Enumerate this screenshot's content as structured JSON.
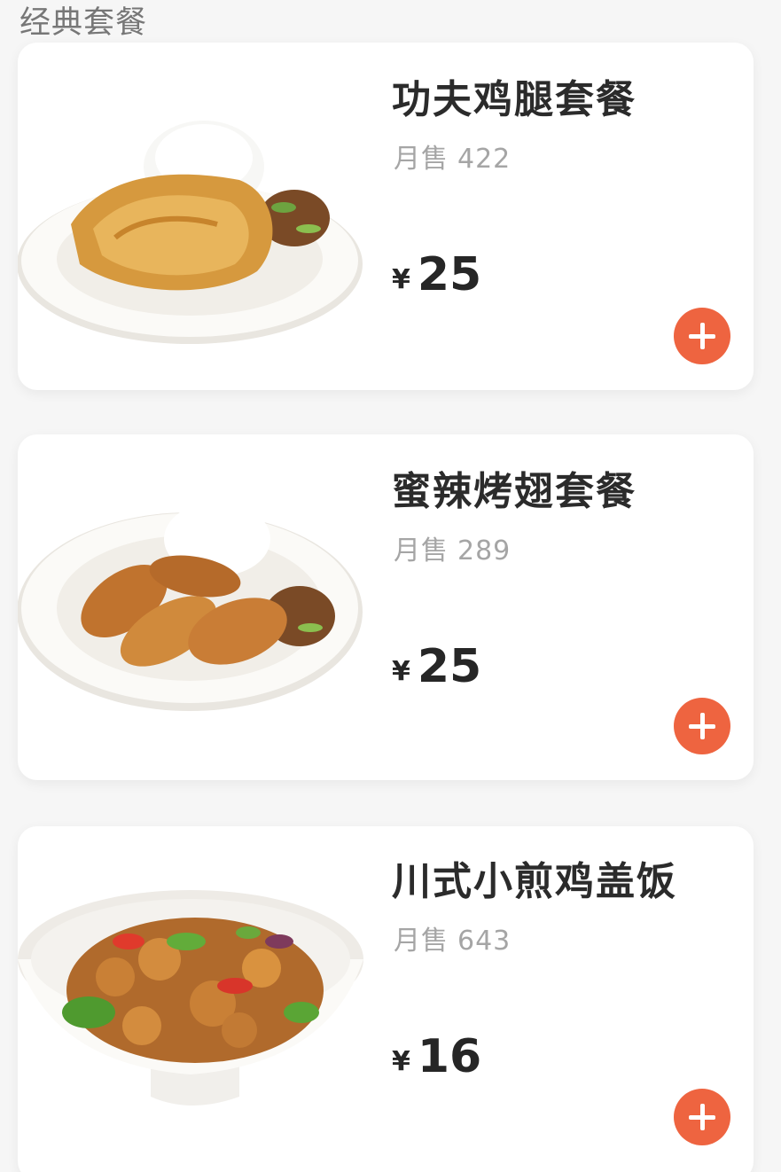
{
  "section": {
    "title": "经典套餐"
  },
  "currency": "¥",
  "colors": {
    "accent": "#ee6440",
    "sales_text": "#a5a5a5"
  },
  "items": [
    {
      "name": "功夫鸡腿套餐",
      "sales_label": "月售",
      "sales_count": "422",
      "price": "25",
      "action_icon": "plus-icon"
    },
    {
      "name": "蜜辣烤翅套餐",
      "sales_label": "月售",
      "sales_count": "289",
      "price": "25",
      "action_icon": "plus-icon"
    },
    {
      "name": "川式小煎鸡盖饭",
      "sales_label": "月售",
      "sales_count": "643",
      "price": "16",
      "action_icon": "plus-icon"
    }
  ]
}
